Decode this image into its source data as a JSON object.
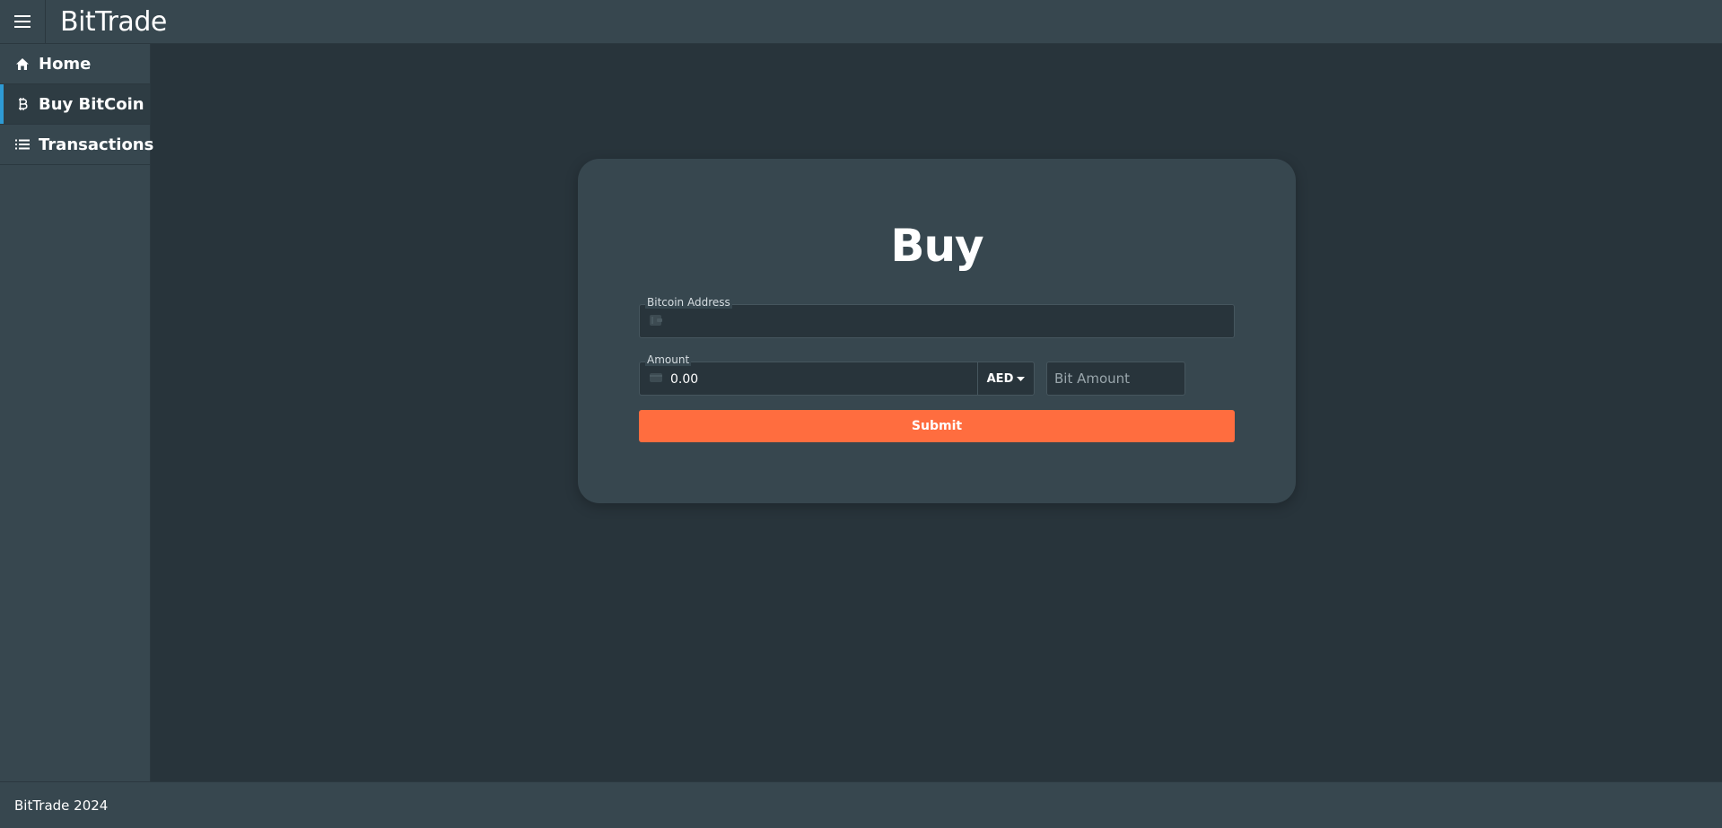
{
  "app": {
    "title": "BitTrade"
  },
  "header": {
    "menu_icon": "hamburger-menu-icon"
  },
  "sidebar": {
    "items": [
      {
        "label": "Home",
        "icon": "home-icon",
        "active": false
      },
      {
        "label": "Buy BitCoin",
        "icon": "bitcoin-icon",
        "active": true
      },
      {
        "label": "Transactions",
        "icon": "list-icon",
        "active": false
      }
    ]
  },
  "buy_form": {
    "title": "Buy",
    "address": {
      "label": "Bitcoin Address",
      "value": "",
      "icon": "wallet-icon"
    },
    "amount": {
      "label": "Amount",
      "value": "0.00",
      "icon": "money-icon"
    },
    "currency": {
      "selected": "AED"
    },
    "bit_amount": {
      "placeholder": "Bit Amount",
      "value": ""
    },
    "submit_label": "Submit"
  },
  "footer": {
    "text": "BitTrade 2024"
  },
  "colors": {
    "background": "#28343b",
    "panel": "#37474f",
    "accent": "#ff6d3f",
    "active_indicator": "#2e9ad4"
  }
}
